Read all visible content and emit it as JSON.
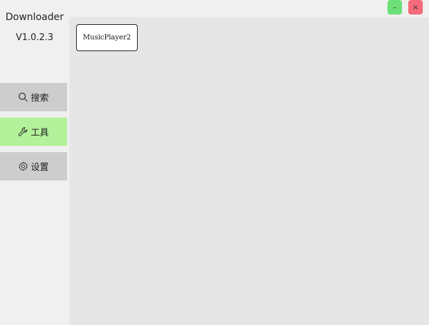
{
  "app": {
    "title": "Downloader",
    "version": "V1.0.2.3"
  },
  "window_controls": {
    "minimize_label": "–",
    "close_label": "×"
  },
  "sidebar": {
    "items": [
      {
        "label": "搜索",
        "icon": "search-icon",
        "active": false
      },
      {
        "label": "工具",
        "icon": "wrench-icon",
        "active": true
      },
      {
        "label": "设置",
        "icon": "gear-icon",
        "active": false
      }
    ]
  },
  "main": {
    "tools": [
      {
        "label": "MusicPlayer2"
      }
    ]
  },
  "colors": {
    "active_nav": "#b3f19a",
    "nav": "#cdcdcd",
    "content_bg": "#e6e6e6",
    "minimize": "#6ee07a",
    "close": "#f46a7a"
  }
}
